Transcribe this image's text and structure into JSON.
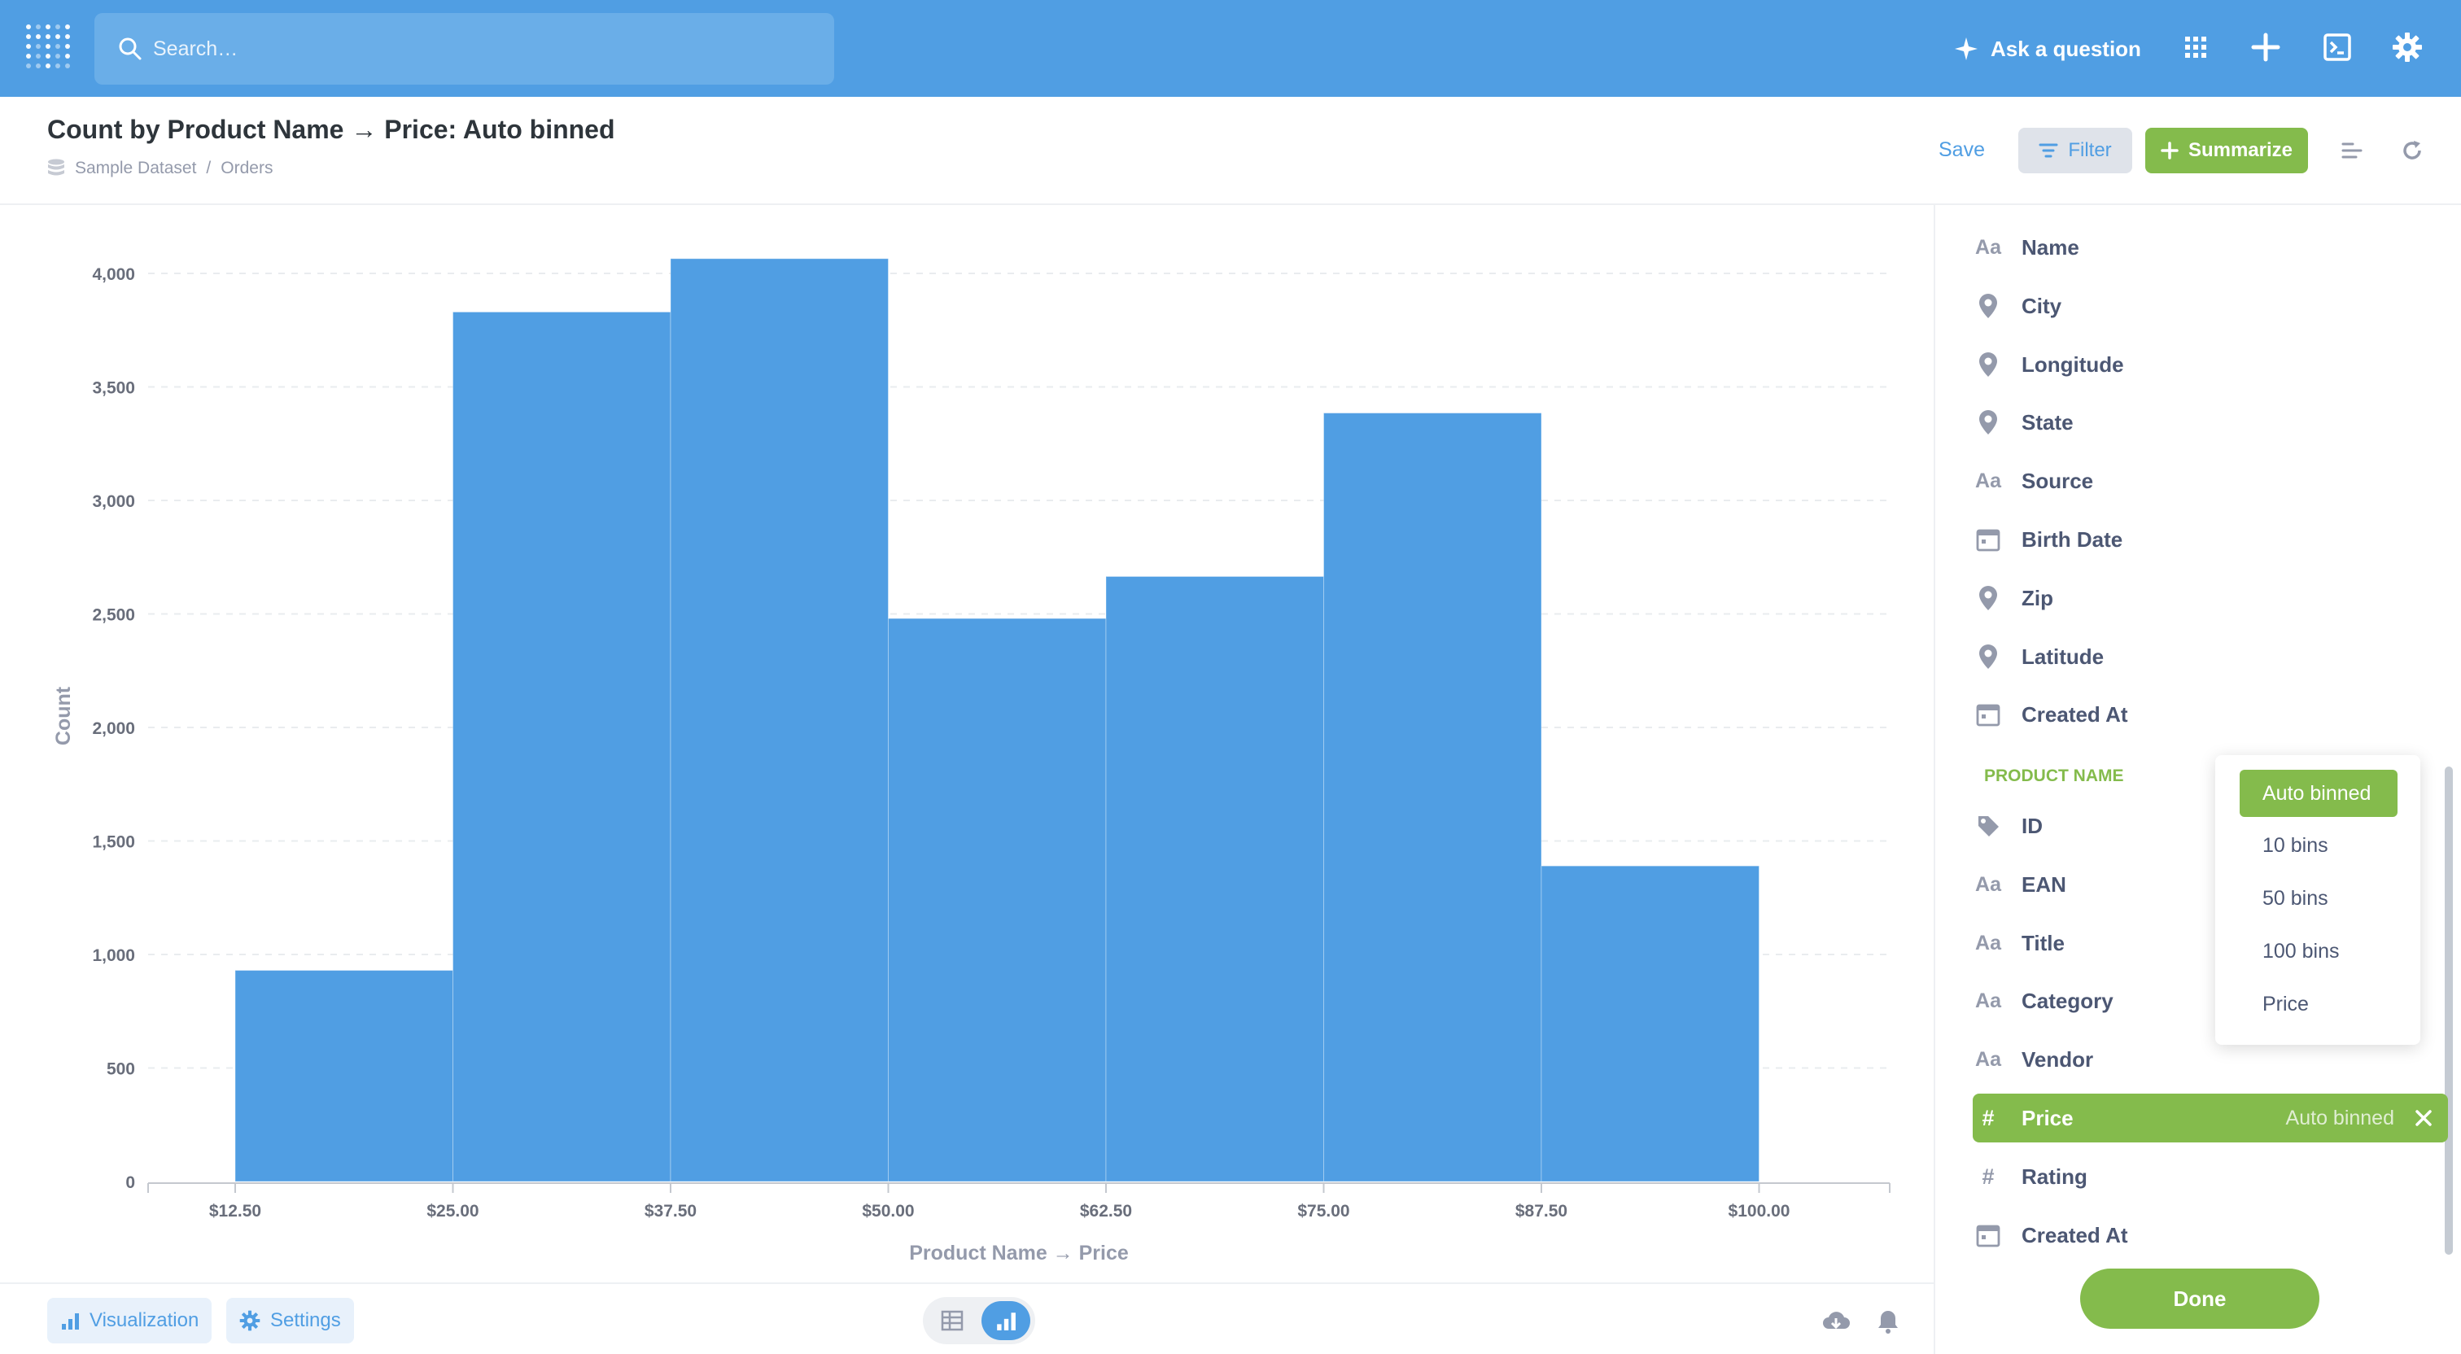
{
  "nav": {
    "search_placeholder": "Search…",
    "ask_label": "Ask a question"
  },
  "header": {
    "title": "Count by Product Name → Price: Auto binned",
    "breadcrumb": [
      "Sample Dataset",
      "Orders"
    ],
    "breadcrumb_sep": "/",
    "save_label": "Save",
    "filter_label": "Filter",
    "summarize_label": "Summarize"
  },
  "chart_data": {
    "type": "bar",
    "xlabel": "Product Name → Price",
    "ylabel": "Count",
    "x_ticks": [
      "$12.50",
      "$25.00",
      "$37.50",
      "$50.00",
      "$62.50",
      "$75.00",
      "$87.50",
      "$100.00"
    ],
    "bins": [
      {
        "from": 12.5,
        "to": 25.0,
        "value": 930
      },
      {
        "from": 25.0,
        "to": 37.5,
        "value": 3830
      },
      {
        "from": 37.5,
        "to": 50.0,
        "value": 4065
      },
      {
        "from": 50.0,
        "to": 62.5,
        "value": 2480
      },
      {
        "from": 62.5,
        "to": 75.0,
        "value": 2665
      },
      {
        "from": 75.0,
        "to": 87.5,
        "value": 3385
      },
      {
        "from": 87.5,
        "to": 100.0,
        "value": 1390
      }
    ],
    "y_ticks": [
      "0",
      "500",
      "1,000",
      "1,500",
      "2,000",
      "2,500",
      "3,000",
      "3,500",
      "4,000"
    ],
    "ylim": [
      0,
      4000
    ],
    "xlim": [
      7.5,
      107.5
    ],
    "grid": true,
    "color": "#509ee3"
  },
  "sidebar": {
    "fields_top": [
      {
        "icon": "text-icon",
        "label": "Name"
      },
      {
        "icon": "location-icon",
        "label": "City"
      },
      {
        "icon": "location-icon",
        "label": "Longitude"
      },
      {
        "icon": "location-icon",
        "label": "State"
      },
      {
        "icon": "text-icon",
        "label": "Source"
      },
      {
        "icon": "calendar-icon",
        "label": "Birth Date"
      },
      {
        "icon": "location-icon",
        "label": "Zip"
      },
      {
        "icon": "location-icon",
        "label": "Latitude"
      },
      {
        "icon": "calendar-icon",
        "label": "Created At"
      }
    ],
    "section_label": "PRODUCT NAME",
    "fields_product": [
      {
        "icon": "tag-icon",
        "label": "ID"
      },
      {
        "icon": "text-icon",
        "label": "EAN"
      },
      {
        "icon": "text-icon",
        "label": "Title"
      },
      {
        "icon": "text-icon",
        "label": "Category"
      },
      {
        "icon": "text-icon",
        "label": "Vendor"
      },
      {
        "icon": "number-icon",
        "label": "Price",
        "binning": "Auto binned"
      },
      {
        "icon": "number-icon",
        "label": "Rating"
      },
      {
        "icon": "calendar-icon",
        "label": "Created At"
      }
    ],
    "done_label": "Done",
    "text_glyph": "Aa",
    "number_glyph": "#"
  },
  "binning_menu": {
    "options": [
      "Auto binned",
      "10 bins",
      "50 bins",
      "100 bins",
      "Price"
    ],
    "selected": "Auto binned"
  },
  "footer": {
    "visualization_label": "Visualization",
    "settings_label": "Settings"
  },
  "colors": {
    "brand": "#509ee3",
    "summarize": "#84bb4c"
  }
}
